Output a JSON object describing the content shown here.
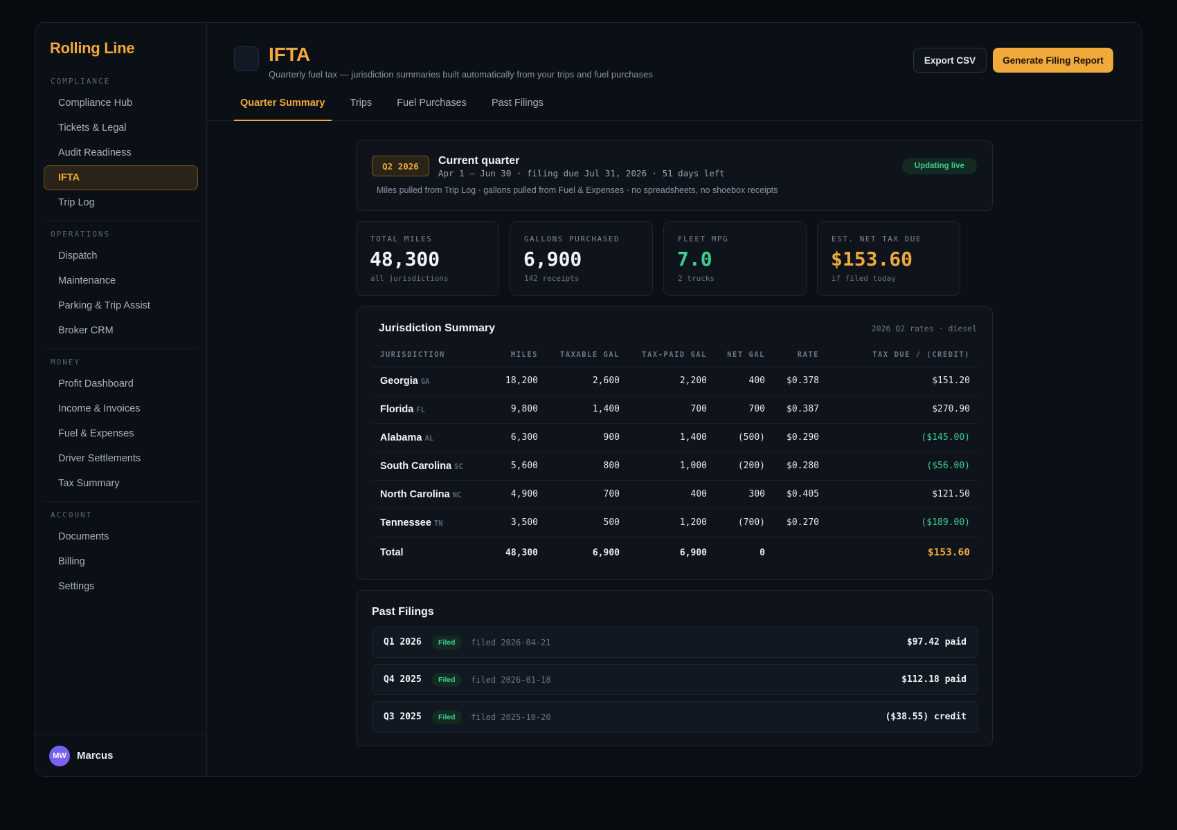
{
  "app": {
    "name": "Rolling Line"
  },
  "sidebar": {
    "sections": [
      {
        "label": "COMPLIANCE",
        "items": [
          "Compliance Hub",
          "Tickets & Legal",
          "Audit Readiness",
          "IFTA",
          "Trip Log"
        ]
      },
      {
        "label": "OPERATIONS",
        "items": [
          "Dispatch",
          "Maintenance",
          "Parking & Trip Assist",
          "Broker CRM"
        ]
      },
      {
        "label": "MONEY",
        "items": [
          "Profit Dashboard",
          "Income & Invoices",
          "Fuel & Expenses",
          "Driver Settlements",
          "Tax Summary"
        ]
      },
      {
        "label": "ACCOUNT",
        "items": [
          "Documents",
          "Billing",
          "Settings"
        ]
      }
    ],
    "active_item": "IFTA",
    "user": {
      "initials": "MW",
      "name": "Marcus"
    }
  },
  "header": {
    "title": "IFTA",
    "subtitle": "Quarterly fuel tax — jurisdiction summaries built automatically from your trips and fuel purchases",
    "export_label": "Export CSV",
    "generate_label": "Generate Filing Report"
  },
  "tabs": [
    "Quarter Summary",
    "Trips",
    "Fuel Purchases",
    "Past Filings"
  ],
  "active_tab": "Quarter Summary",
  "quarter": {
    "badge": "Q2 2026",
    "title": "Current quarter",
    "meta": "Apr 1 – Jun 30 · filing due Jul 31, 2026 · 51 days left",
    "note": "Miles pulled from Trip Log · gallons pulled from Fuel & Expenses · no spreadsheets, no shoebox receipts",
    "status": "Updating live"
  },
  "stats": [
    {
      "label": "TOTAL MILES",
      "value": "48,300",
      "sub": "all jurisdictions",
      "color": "#f2f4f7"
    },
    {
      "label": "GALLONS PURCHASED",
      "value": "6,900",
      "sub": "142 receipts",
      "color": "#f2f4f7"
    },
    {
      "label": "FLEET MPG",
      "value": "7.0",
      "sub": "2 trucks",
      "color": "#3ecf8e"
    },
    {
      "label": "EST. NET TAX DUE",
      "value": "$153.60",
      "sub": "if filed today",
      "color": "#f0a93b"
    }
  ],
  "jurisdictions": {
    "title": "Jurisdiction Summary",
    "note": "2026 Q2 rates · diesel",
    "columns": [
      "JURISDICTION",
      "MILES",
      "TAXABLE GAL",
      "TAX-PAID GAL",
      "NET GAL",
      "RATE",
      "TAX DUE / (CREDIT)"
    ],
    "rows": [
      {
        "name": "Georgia",
        "abbr": "GA",
        "miles": "18,200",
        "taxable": "2,600",
        "paid": "2,200",
        "net": "400",
        "rate": "$0.378",
        "due": "$151.20",
        "credit": false
      },
      {
        "name": "Florida",
        "abbr": "FL",
        "miles": "9,800",
        "taxable": "1,400",
        "paid": "700",
        "net": "700",
        "rate": "$0.387",
        "due": "$270.90",
        "credit": false
      },
      {
        "name": "Alabama",
        "abbr": "AL",
        "miles": "6,300",
        "taxable": "900",
        "paid": "1,400",
        "net": "(500)",
        "rate": "$0.290",
        "due": "($145.00)",
        "credit": true
      },
      {
        "name": "South Carolina",
        "abbr": "SC",
        "miles": "5,600",
        "taxable": "800",
        "paid": "1,000",
        "net": "(200)",
        "rate": "$0.280",
        "due": "($56.00)",
        "credit": true
      },
      {
        "name": "North Carolina",
        "abbr": "NC",
        "miles": "4,900",
        "taxable": "700",
        "paid": "400",
        "net": "300",
        "rate": "$0.405",
        "due": "$121.50",
        "credit": false
      },
      {
        "name": "Tennessee",
        "abbr": "TN",
        "miles": "3,500",
        "taxable": "500",
        "paid": "1,200",
        "net": "(700)",
        "rate": "$0.270",
        "due": "($189.00)",
        "credit": true
      }
    ],
    "total": {
      "label": "Total",
      "miles": "48,300",
      "taxable": "6,900",
      "paid": "6,900",
      "net": "0",
      "rate": "",
      "due": "$153.60"
    }
  },
  "past_filings": {
    "title": "Past Filings",
    "rows": [
      {
        "quarter": "Q1 2026",
        "status": "Filed",
        "date": "filed 2026-04-21",
        "amount": "$97.42 paid"
      },
      {
        "quarter": "Q4 2025",
        "status": "Filed",
        "date": "filed 2026-01-18",
        "amount": "$112.18 paid"
      },
      {
        "quarter": "Q3 2025",
        "status": "Filed",
        "date": "filed 2025-10-20",
        "amount": "($38.55) credit"
      }
    ]
  }
}
